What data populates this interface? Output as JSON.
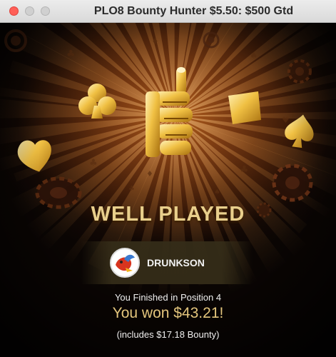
{
  "window": {
    "title": "PLO8 Bounty Hunter $5.50: $500 Gtd"
  },
  "result": {
    "headline": "WELL PLAYED",
    "player_name": "DRUNKSON",
    "finished_text": "You Finished in Position 4",
    "won_text": "You won $43.21!",
    "bounty_text": "(includes $17.18 Bounty)"
  },
  "colors": {
    "accent_gold": "#e9cf8c",
    "background_glow": "#b4601c"
  },
  "icons": [
    "thumbs-up-icon",
    "club-icon",
    "heart-icon",
    "diamond-icon",
    "spade-icon",
    "poker-chip-icon",
    "gear-icon"
  ]
}
